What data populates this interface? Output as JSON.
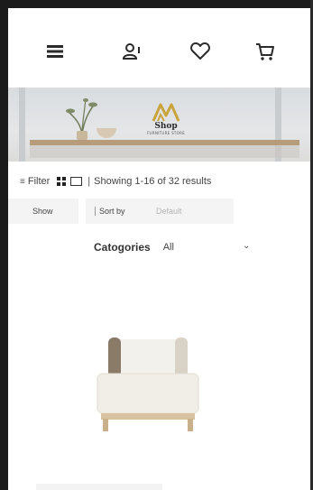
{
  "header": {
    "icons": [
      "menu-icon",
      "user-icon",
      "heart-icon",
      "cart-icon"
    ]
  },
  "banner": {
    "logo_text": "Shop",
    "logo_subtext": "FURNITURE STORE",
    "logo_color": "#c9a43a"
  },
  "toolbar": {
    "filter_label": "Filter",
    "separator": "|",
    "results_text": "Showing 1-16 of 32 results"
  },
  "controls": {
    "show_label": "Show",
    "sort_label": "Sort by",
    "sort_value": "Default",
    "categories_label": "Catogories",
    "categories_value": "All"
  },
  "product": {
    "image": "armchair-product-image"
  },
  "colors": {
    "frame": "#1b1b1b",
    "panel": "#f4f4f4",
    "text": "#222222",
    "muted": "#b5b5b5"
  }
}
